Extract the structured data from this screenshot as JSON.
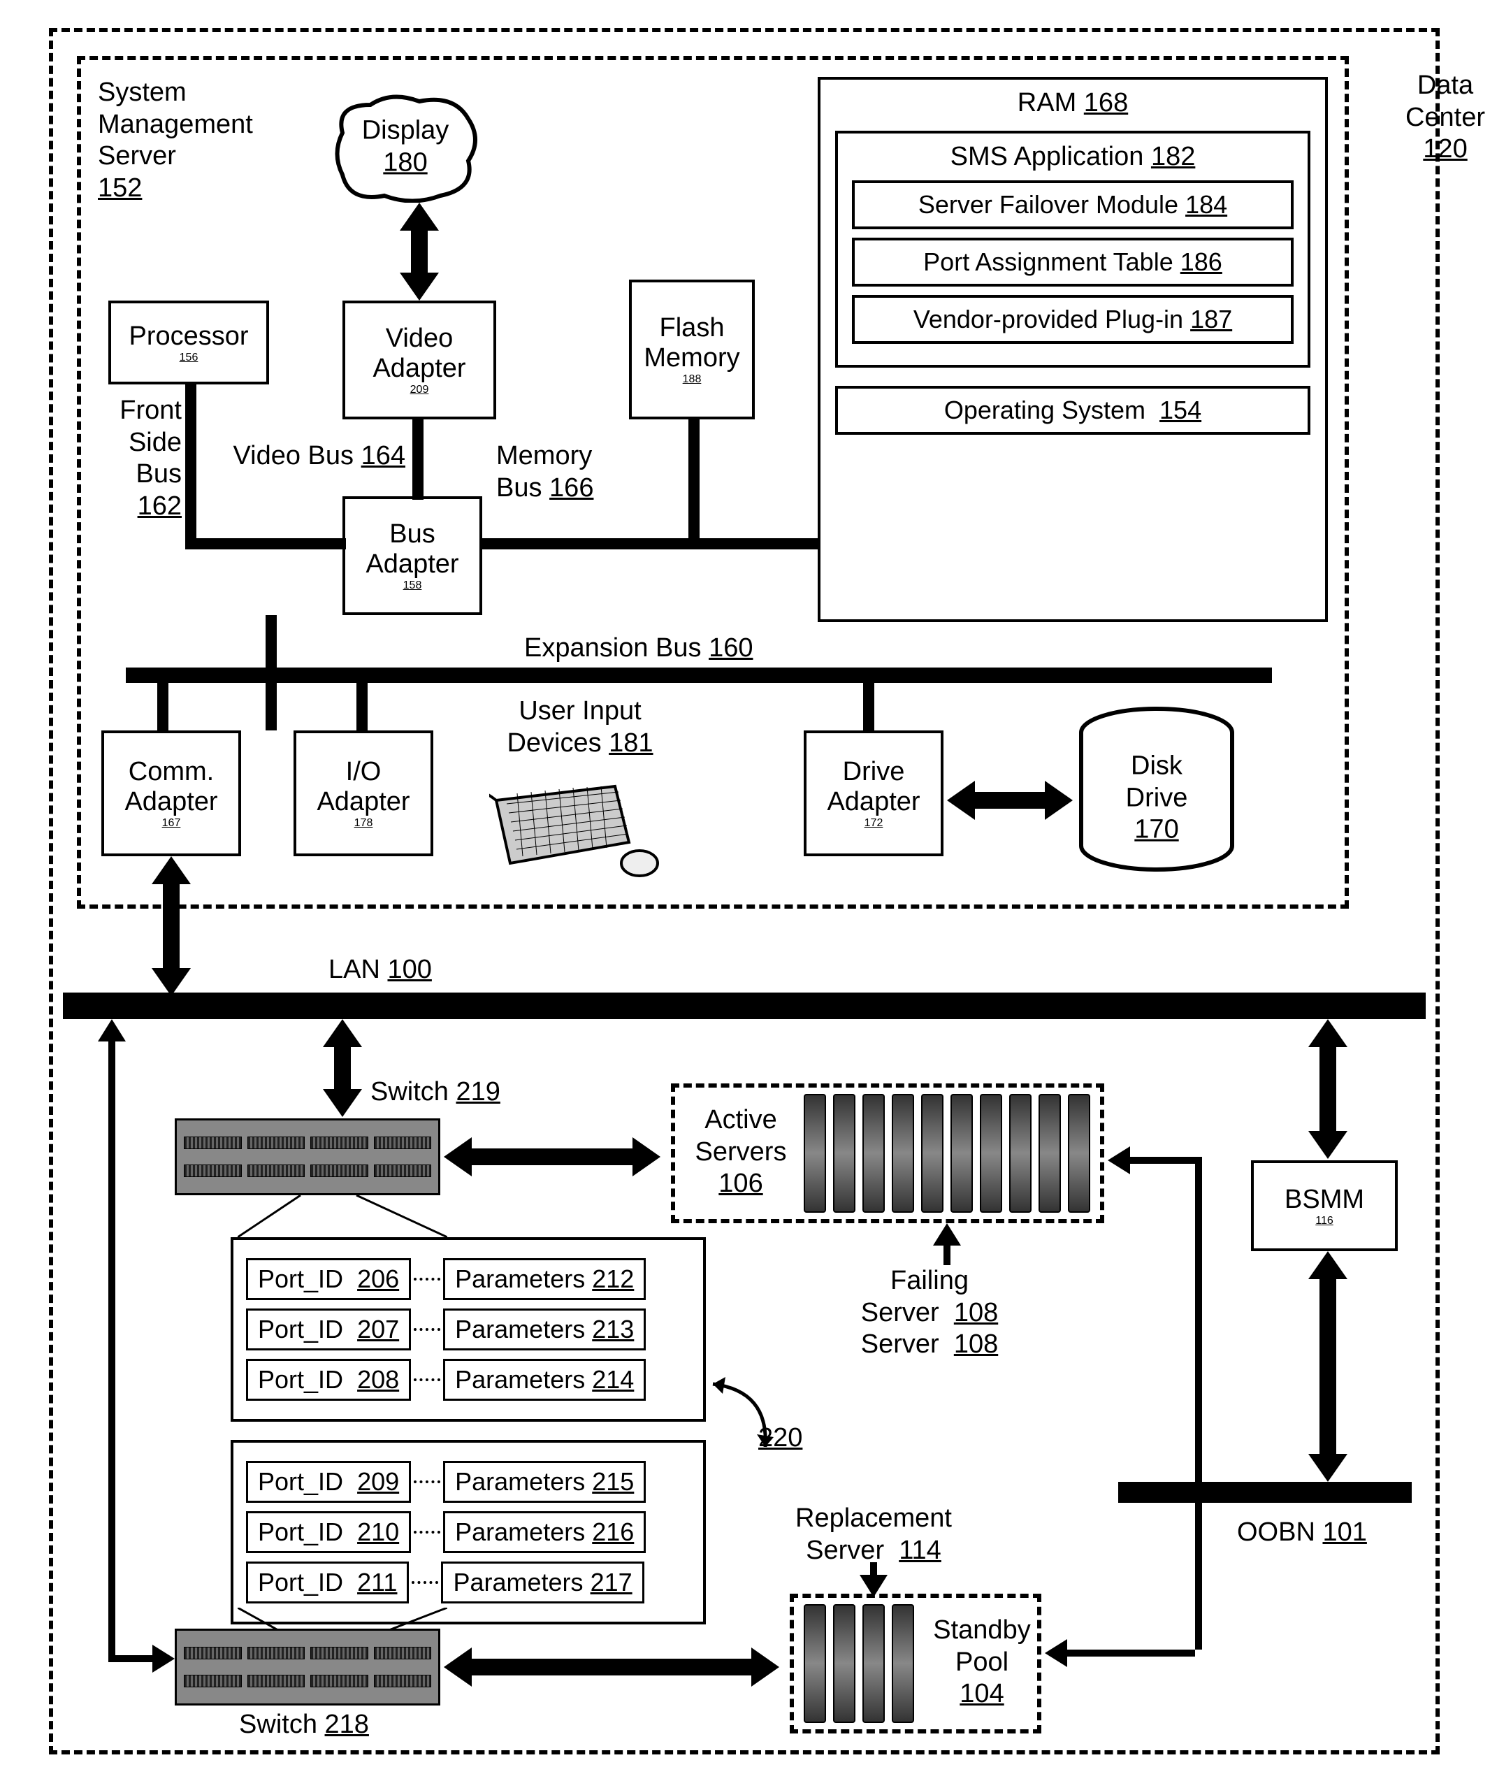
{
  "data_center": {
    "label": "Data\nCenter",
    "ref": "120"
  },
  "sms": {
    "label": "System\nManagement\nServer",
    "ref": "152"
  },
  "display": {
    "label": "Display",
    "ref": "180"
  },
  "processor": {
    "label": "Processor",
    "ref": "156"
  },
  "video_adapter": {
    "label": "Video\nAdapter",
    "ref": "209"
  },
  "flash_memory": {
    "label": "Flash\nMemory",
    "ref": "188"
  },
  "front_side_bus": {
    "label": "Front\nSide\nBus",
    "ref": "162"
  },
  "video_bus": {
    "label": "Video Bus",
    "ref": "164"
  },
  "memory_bus": {
    "label": "Memory\nBus",
    "ref": "166"
  },
  "bus_adapter": {
    "label": "Bus\nAdapter",
    "ref": "158"
  },
  "expansion_bus": {
    "label": "Expansion Bus",
    "ref": "160"
  },
  "ram": {
    "label": "RAM",
    "ref": "168"
  },
  "sms_app": {
    "label": "SMS Application",
    "ref": "182"
  },
  "failover": {
    "label": "Server Failover Module",
    "ref": "184"
  },
  "port_assign": {
    "label": "Port Assignment Table",
    "ref": "186"
  },
  "plugin": {
    "label": "Vendor-provided Plug-in",
    "ref": "187"
  },
  "os": {
    "label": "Operating System",
    "ref": "154"
  },
  "comm_adapter": {
    "label": "Comm.\nAdapter",
    "ref": "167"
  },
  "io_adapter": {
    "label": "I/O\nAdapter",
    "ref": "178"
  },
  "user_input": {
    "label": "User Input\nDevices",
    "ref": "181"
  },
  "drive_adapter": {
    "label": "Drive\nAdapter",
    "ref": "172"
  },
  "disk_drive": {
    "label": "Disk\nDrive",
    "ref": "170"
  },
  "lan": {
    "label": "LAN",
    "ref": "100"
  },
  "switch_219": {
    "label": "Switch",
    "ref": "219"
  },
  "switch_218": {
    "label": "Switch",
    "ref": "218"
  },
  "active_servers": {
    "label": "Active\nServers",
    "ref": "106"
  },
  "failing_server": {
    "label": "Failing\nServer",
    "ref": "108"
  },
  "replacement_server": {
    "label": "Replacement\nServer",
    "ref": "114"
  },
  "standby_pool": {
    "label": "Standby\nPool",
    "ref": "104"
  },
  "bsmm": {
    "label": "BSMM",
    "ref": "116"
  },
  "oobn": {
    "label": "OOBN",
    "ref": "101"
  },
  "mapping_ref": "220",
  "port_tables": {
    "upper": [
      {
        "port_label": "Port_ID",
        "port_ref": "206",
        "param_label": "Parameters",
        "param_ref": "212"
      },
      {
        "port_label": "Port_ID",
        "port_ref": "207",
        "param_label": "Parameters",
        "param_ref": "213"
      },
      {
        "port_label": "Port_ID",
        "port_ref": "208",
        "param_label": "Parameters",
        "param_ref": "214"
      }
    ],
    "lower": [
      {
        "port_label": "Port_ID",
        "port_ref": "209",
        "param_label": "Parameters",
        "param_ref": "215"
      },
      {
        "port_label": "Port_ID",
        "port_ref": "210",
        "param_label": "Parameters",
        "param_ref": "216"
      },
      {
        "port_label": "Port_ID",
        "port_ref": "211",
        "param_label": "Parameters",
        "param_ref": "217"
      }
    ]
  }
}
